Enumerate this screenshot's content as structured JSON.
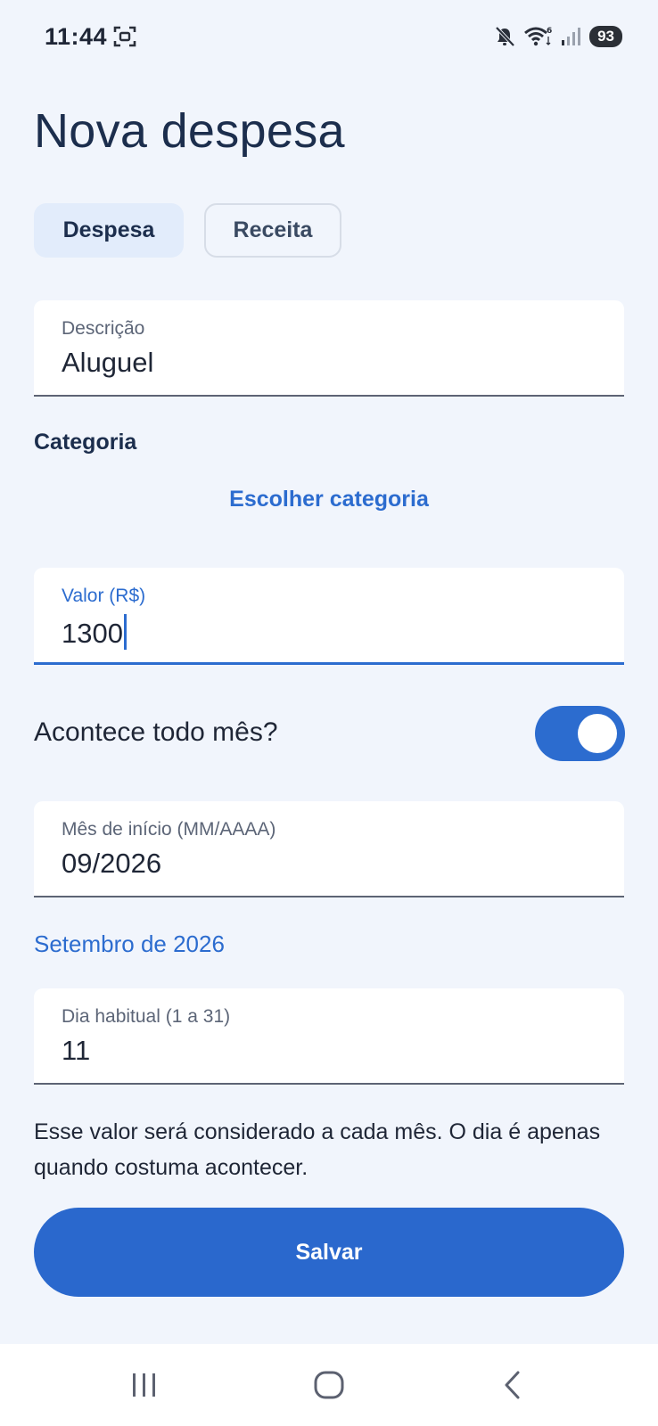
{
  "status_bar": {
    "time": "11:44",
    "battery": "93",
    "icons": [
      "screenshot-icon",
      "mute-icon",
      "wifi-icon",
      "signal-icon",
      "battery-icon"
    ]
  },
  "page": {
    "title": "Nova despesa"
  },
  "type_selector": {
    "options": [
      {
        "label": "Despesa",
        "selected": true
      },
      {
        "label": "Receita",
        "selected": false
      }
    ]
  },
  "fields": {
    "description": {
      "label": "Descrição",
      "value": "Aluguel"
    },
    "amount": {
      "label": "Valor (R$)",
      "value": "1300",
      "focused": true
    },
    "start_month": {
      "label": "Mês de início (MM/AAAA)",
      "value": "09/2026"
    },
    "usual_day": {
      "label": "Dia habitual (1 a 31)",
      "value": "11"
    }
  },
  "category": {
    "label": "Categoria",
    "action": "Escolher categoria"
  },
  "recurring": {
    "label": "Acontece todo mês?",
    "enabled": true
  },
  "start_month_helper": "Setembro de 2026",
  "hint": "Esse valor será considerado a cada mês. O dia é apenas quando costuma acontecer.",
  "save_label": "Salvar",
  "colors": {
    "background": "#f1f5fc",
    "accent": "#2c6ccf",
    "title": "#1c2e4d",
    "selected_chip": "#e2ecfb"
  },
  "nav_bar": {
    "icons": [
      "recents-icon",
      "home-icon",
      "back-icon"
    ]
  }
}
